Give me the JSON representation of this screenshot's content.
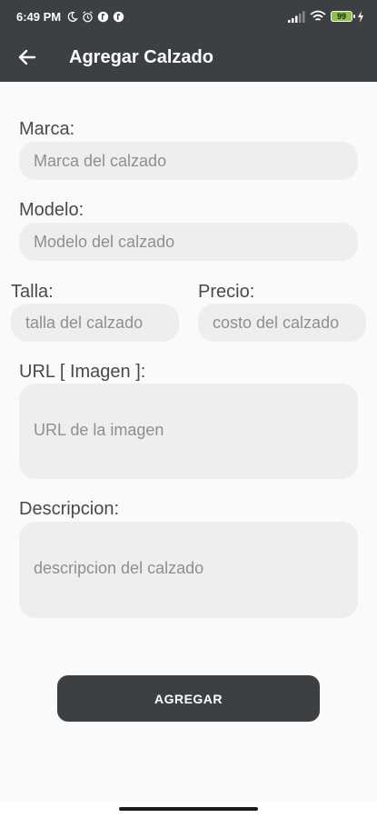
{
  "status_bar": {
    "time": "6:49 PM",
    "battery_level": "99",
    "left_icons": [
      "moon-icon",
      "alarm-icon",
      "app-icon",
      "app-icon"
    ],
    "right_icons": [
      "signal-icon",
      "wifi-icon",
      "battery-icon",
      "charging-icon"
    ]
  },
  "app_bar": {
    "title": "Agregar Calzado",
    "back_icon": "arrow-back-icon",
    "background": "#3d4043"
  },
  "form": {
    "marca": {
      "label": "Marca:",
      "placeholder": "Marca del calzado",
      "value": ""
    },
    "modelo": {
      "label": "Modelo:",
      "placeholder": "Modelo del calzado",
      "value": ""
    },
    "talla": {
      "label": "Talla:",
      "placeholder": "talla del calzado",
      "value": ""
    },
    "precio": {
      "label": "Precio:",
      "placeholder": "costo del calzado",
      "value": ""
    },
    "url": {
      "label": "URL [ Imagen ]:",
      "placeholder": "URL de la imagen",
      "value": ""
    },
    "descripcion": {
      "label": "Descripcion:",
      "placeholder": "descripcion del calzado",
      "value": ""
    }
  },
  "submit": {
    "label": "AGREGAR"
  },
  "colors": {
    "bar": "#3d4043",
    "field_background": "#eeeeee",
    "battery": "#8bc34a"
  }
}
